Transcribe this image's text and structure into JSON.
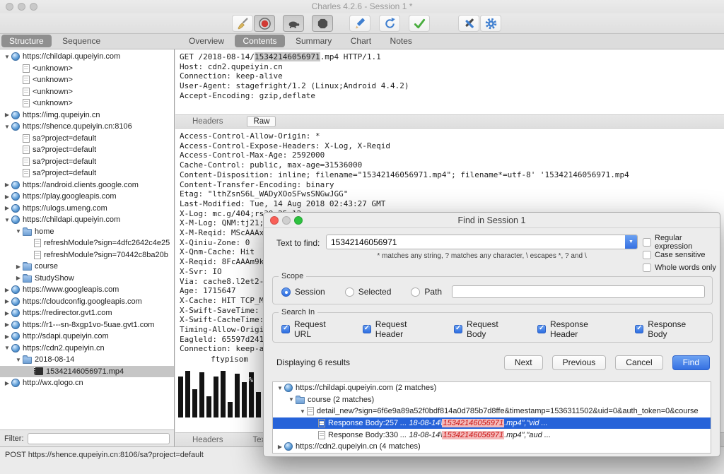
{
  "window": {
    "title": "Charles 4.2.6 - Session 1 *"
  },
  "toolbar": {
    "buttons": [
      {
        "name": "clear-session",
        "icon": "broom-icon"
      },
      {
        "name": "record",
        "icon": "record-icon"
      },
      {
        "name": "throttle",
        "icon": "turtle-icon"
      },
      {
        "name": "breakpoints",
        "icon": "breakpoint-icon"
      },
      {
        "name": "compose",
        "icon": "pencil-icon"
      },
      {
        "name": "repeat",
        "icon": "repeat-icon"
      },
      {
        "name": "validate",
        "icon": "check-icon"
      },
      {
        "name": "tools",
        "icon": "tools-icon"
      },
      {
        "name": "settings",
        "icon": "gear-icon"
      }
    ]
  },
  "left_tabs": {
    "structure": "Structure",
    "sequence": "Sequence"
  },
  "content_tabs": {
    "overview": "Overview",
    "contents": "Contents",
    "summary": "Summary",
    "chart": "Chart",
    "notes": "Notes"
  },
  "structure_tree": [
    {
      "label": "https://childapi.qupeiyin.com",
      "indent": 0,
      "arrow": "down",
      "icon": "globe"
    },
    {
      "label": "<unknown>",
      "indent": 1,
      "icon": "doc"
    },
    {
      "label": "<unknown>",
      "indent": 1,
      "icon": "doc"
    },
    {
      "label": "<unknown>",
      "indent": 1,
      "icon": "doc"
    },
    {
      "label": "<unknown>",
      "indent": 1,
      "icon": "doc"
    },
    {
      "label": "https://img.qupeiyin.cn",
      "indent": 0,
      "arrow": "right",
      "icon": "globe"
    },
    {
      "label": "https://shence.qupeiyin.cn:8106",
      "indent": 0,
      "arrow": "down",
      "icon": "globe"
    },
    {
      "label": "sa?project=default",
      "indent": 1,
      "icon": "doc"
    },
    {
      "label": "sa?project=default",
      "indent": 1,
      "icon": "doc"
    },
    {
      "label": "sa?project=default",
      "indent": 1,
      "icon": "doc"
    },
    {
      "label": "sa?project=default",
      "indent": 1,
      "icon": "doc"
    },
    {
      "label": "https://android.clients.google.com",
      "indent": 0,
      "arrow": "right",
      "icon": "globe"
    },
    {
      "label": "https://play.googleapis.com",
      "indent": 0,
      "arrow": "right",
      "icon": "globe"
    },
    {
      "label": "https://ulogs.umeng.com",
      "indent": 0,
      "arrow": "right",
      "icon": "globe"
    },
    {
      "label": "https://childapi.qupeiyin.com",
      "indent": 0,
      "arrow": "down",
      "icon": "globe"
    },
    {
      "label": "home",
      "indent": 1,
      "arrow": "down",
      "icon": "folder"
    },
    {
      "label": "refreshModule?sign=4dfc2642c4e25",
      "indent": 2,
      "icon": "doc"
    },
    {
      "label": "refreshModule?sign=70442c8ba20b",
      "indent": 2,
      "icon": "doc"
    },
    {
      "label": "course",
      "indent": 1,
      "arrow": "right",
      "icon": "folder"
    },
    {
      "label": "StudyShow",
      "indent": 1,
      "arrow": "right",
      "icon": "folder"
    },
    {
      "label": "https://www.googleapis.com",
      "indent": 0,
      "arrow": "right",
      "icon": "globe"
    },
    {
      "label": "https://cloudconfig.googleapis.com",
      "indent": 0,
      "arrow": "right",
      "icon": "globe"
    },
    {
      "label": "https://redirector.gvt1.com",
      "indent": 0,
      "arrow": "right",
      "icon": "globe"
    },
    {
      "label": "https://r1---sn-8xgp1vo-5uae.gvt1.com",
      "indent": 0,
      "arrow": "right",
      "icon": "globe"
    },
    {
      "label": "http://sdapi.qupeiyin.com",
      "indent": 0,
      "arrow": "right",
      "icon": "globe"
    },
    {
      "label": "https://cdn2.qupeiyin.cn",
      "indent": 0,
      "arrow": "down",
      "icon": "globe"
    },
    {
      "label": "2018-08-14",
      "indent": 1,
      "arrow": "down",
      "icon": "folder"
    },
    {
      "label": "15342146056971.mp4",
      "indent": 2,
      "icon": "movie",
      "selected": true
    },
    {
      "label": "http://wx.qlogo.cn",
      "indent": 0,
      "arrow": "right",
      "icon": "globe"
    }
  ],
  "filter": {
    "label": "Filter:",
    "value": ""
  },
  "request": {
    "line1_pre": "GET /2018-08-14/",
    "match": "15342146056971",
    "line1_post": ".mp4 HTTP/1.1",
    "rest": "\nHost: cdn2.qupeiyin.cn\nConnection: keep-alive\nUser-Agent: stagefright/1.2 (Linux;Android 4.4.2)\nAccept-Encoding: gzip,deflate"
  },
  "response_tabs": {
    "headers": "Headers",
    "raw": "Raw"
  },
  "response_raw": "Access-Control-Allow-Origin: *\nAccess-Control-Expose-Headers: X-Log, X-Reqid\nAccess-Control-Max-Age: 2592000\nCache-Control: public, max-age=31536000\nContent-Disposition: inline; filename=\"15342146056971.mp4\"; filename*=utf-8' '15342146056971.mp4\nContent-Transfer-Encoding: binary\nEtag: \"lthZsnS6L_WADyXOoSFwsSNGwJGG\"\nLast-Modified: Tue, 14 Aug 2018 02:43:27 GMT\nX-Log: mc.g/404;rs39.25:12\nX-M-Log: QNM:tj21;QN\nX-M-Reqid: MScAAAxx\nX-Qiniu-Zone: 0\nX-Qnm-Cache: Hit\nX-Reqid: 8FcAAAm9kq\nX-Svr: IO\nVia: cache8.l2et2-2[0,\nAge: 1715647\nX-Cache: HIT TCP_ME\nX-Swift-SaveTime: Mo\nX-Swift-CacheTime: 2\nTiming-Allow-Origin: *\nEagleld: 65597d24153\nConnection: keep-aliv",
  "hex_preview": {
    "text": "ftypisom",
    "percent": "%"
  },
  "bottom_tabs": {
    "headers": "Headers",
    "text": "Text"
  },
  "status_bar": {
    "text": "POST https://shence.qupeiyin.cn:8106/sa?project=default"
  },
  "find_dialog": {
    "title": "Find in Session 1",
    "text_to_find_label": "Text to find:",
    "search_value": "15342146056971",
    "hint": "* matches any string, ? matches any character, \\ escapes *, ? and \\",
    "options": [
      {
        "label": "Regular expression",
        "checked": false
      },
      {
        "label": "Case sensitive",
        "checked": false
      },
      {
        "label": "Whole words only",
        "checked": false
      }
    ],
    "scope": {
      "legend": "Scope",
      "options": [
        {
          "label": "Session",
          "selected": true
        },
        {
          "label": "Selected",
          "selected": false
        },
        {
          "label": "Path",
          "selected": false
        }
      ],
      "path_value": ""
    },
    "search_in": {
      "legend": "Search In",
      "options": [
        {
          "label": "Request URL",
          "checked": true
        },
        {
          "label": "Request Header",
          "checked": true
        },
        {
          "label": "Request Body",
          "checked": true
        },
        {
          "label": "Response Header",
          "checked": true
        },
        {
          "label": "Response Body",
          "checked": true
        }
      ]
    },
    "results_summary": "Displaying 6 results",
    "buttons": {
      "next": "Next",
      "previous": "Previous",
      "cancel": "Cancel",
      "find": "Find"
    },
    "results": [
      {
        "indent": 0,
        "arrow": "down",
        "icon": "globe",
        "label": "https://childapi.qupeiyin.com (2 matches)"
      },
      {
        "indent": 1,
        "arrow": "down",
        "icon": "folder",
        "label": "course (2 matches)"
      },
      {
        "indent": 2,
        "arrow": "down",
        "icon": "doc",
        "label": "detail_new?sign=6f6e9a89a52f0bdf814a0d785b7d8ffe&timestamp=1536311502&uid=0&auth_token=0&course"
      },
      {
        "indent": 3,
        "icon": "doc",
        "selected": true,
        "prefix": "Response Body:257",
        "parts": [
          "   ... 18-08-14\\",
          "15342146056971",
          ".mp4\",\"vid ..."
        ]
      },
      {
        "indent": 3,
        "icon": "doc",
        "prefix": "Response Body:330",
        "parts": [
          "   ... 18-08-14\\",
          "15342146056971",
          ".mp4\",\"aud ..."
        ]
      },
      {
        "indent": 0,
        "arrow": "right",
        "icon": "globe",
        "label": "https://cdn2.qupeiyin.cn (4 matches)"
      }
    ]
  }
}
